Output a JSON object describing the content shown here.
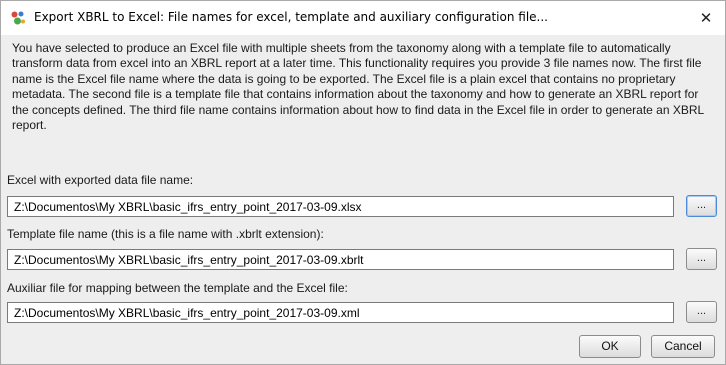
{
  "window": {
    "title": "Export XBRL to Excel: File names for excel, template and auxiliary configuration file...",
    "close_glyph": "✕",
    "app_icon": "app-logo-icon"
  },
  "description": "You have selected to produce an Excel file with multiple sheets from the taxonomy along with a template file to automatically transform data from excel into an XBRL report at a later time. This functionality requires you provide 3 file names now. The first file name is the Excel file name where the data is going to be exported. The Excel file is a plain excel that contains no proprietary metadata. The second file is a template file that contains information about the taxonomy and how to generate an XBRL report for the concepts defined. The third file name contains information about how to find data in the Excel file in order to generate an XBRL report.",
  "fields": {
    "excel": {
      "label": "Excel with exported data file name:",
      "value": "Z:\\Documentos\\My XBRL\\basic_ifrs_entry_point_2017-03-09.xlsx",
      "browse_label": "..."
    },
    "template": {
      "label": "Template file name (this is a file name with .xbrlt extension):",
      "value": "Z:\\Documentos\\My XBRL\\basic_ifrs_entry_point_2017-03-09.xbrlt",
      "browse_label": "..."
    },
    "auxiliar": {
      "label": "Auxiliar file for mapping between the template and the Excel file:",
      "value": "Z:\\Documentos\\My XBRL\\basic_ifrs_entry_point_2017-03-09.xml",
      "browse_label": "..."
    }
  },
  "buttons": {
    "ok": "OK",
    "cancel": "Cancel"
  },
  "colors": {
    "dialog_bg": "#eeeeee",
    "focus_border": "#4c8bd8"
  }
}
